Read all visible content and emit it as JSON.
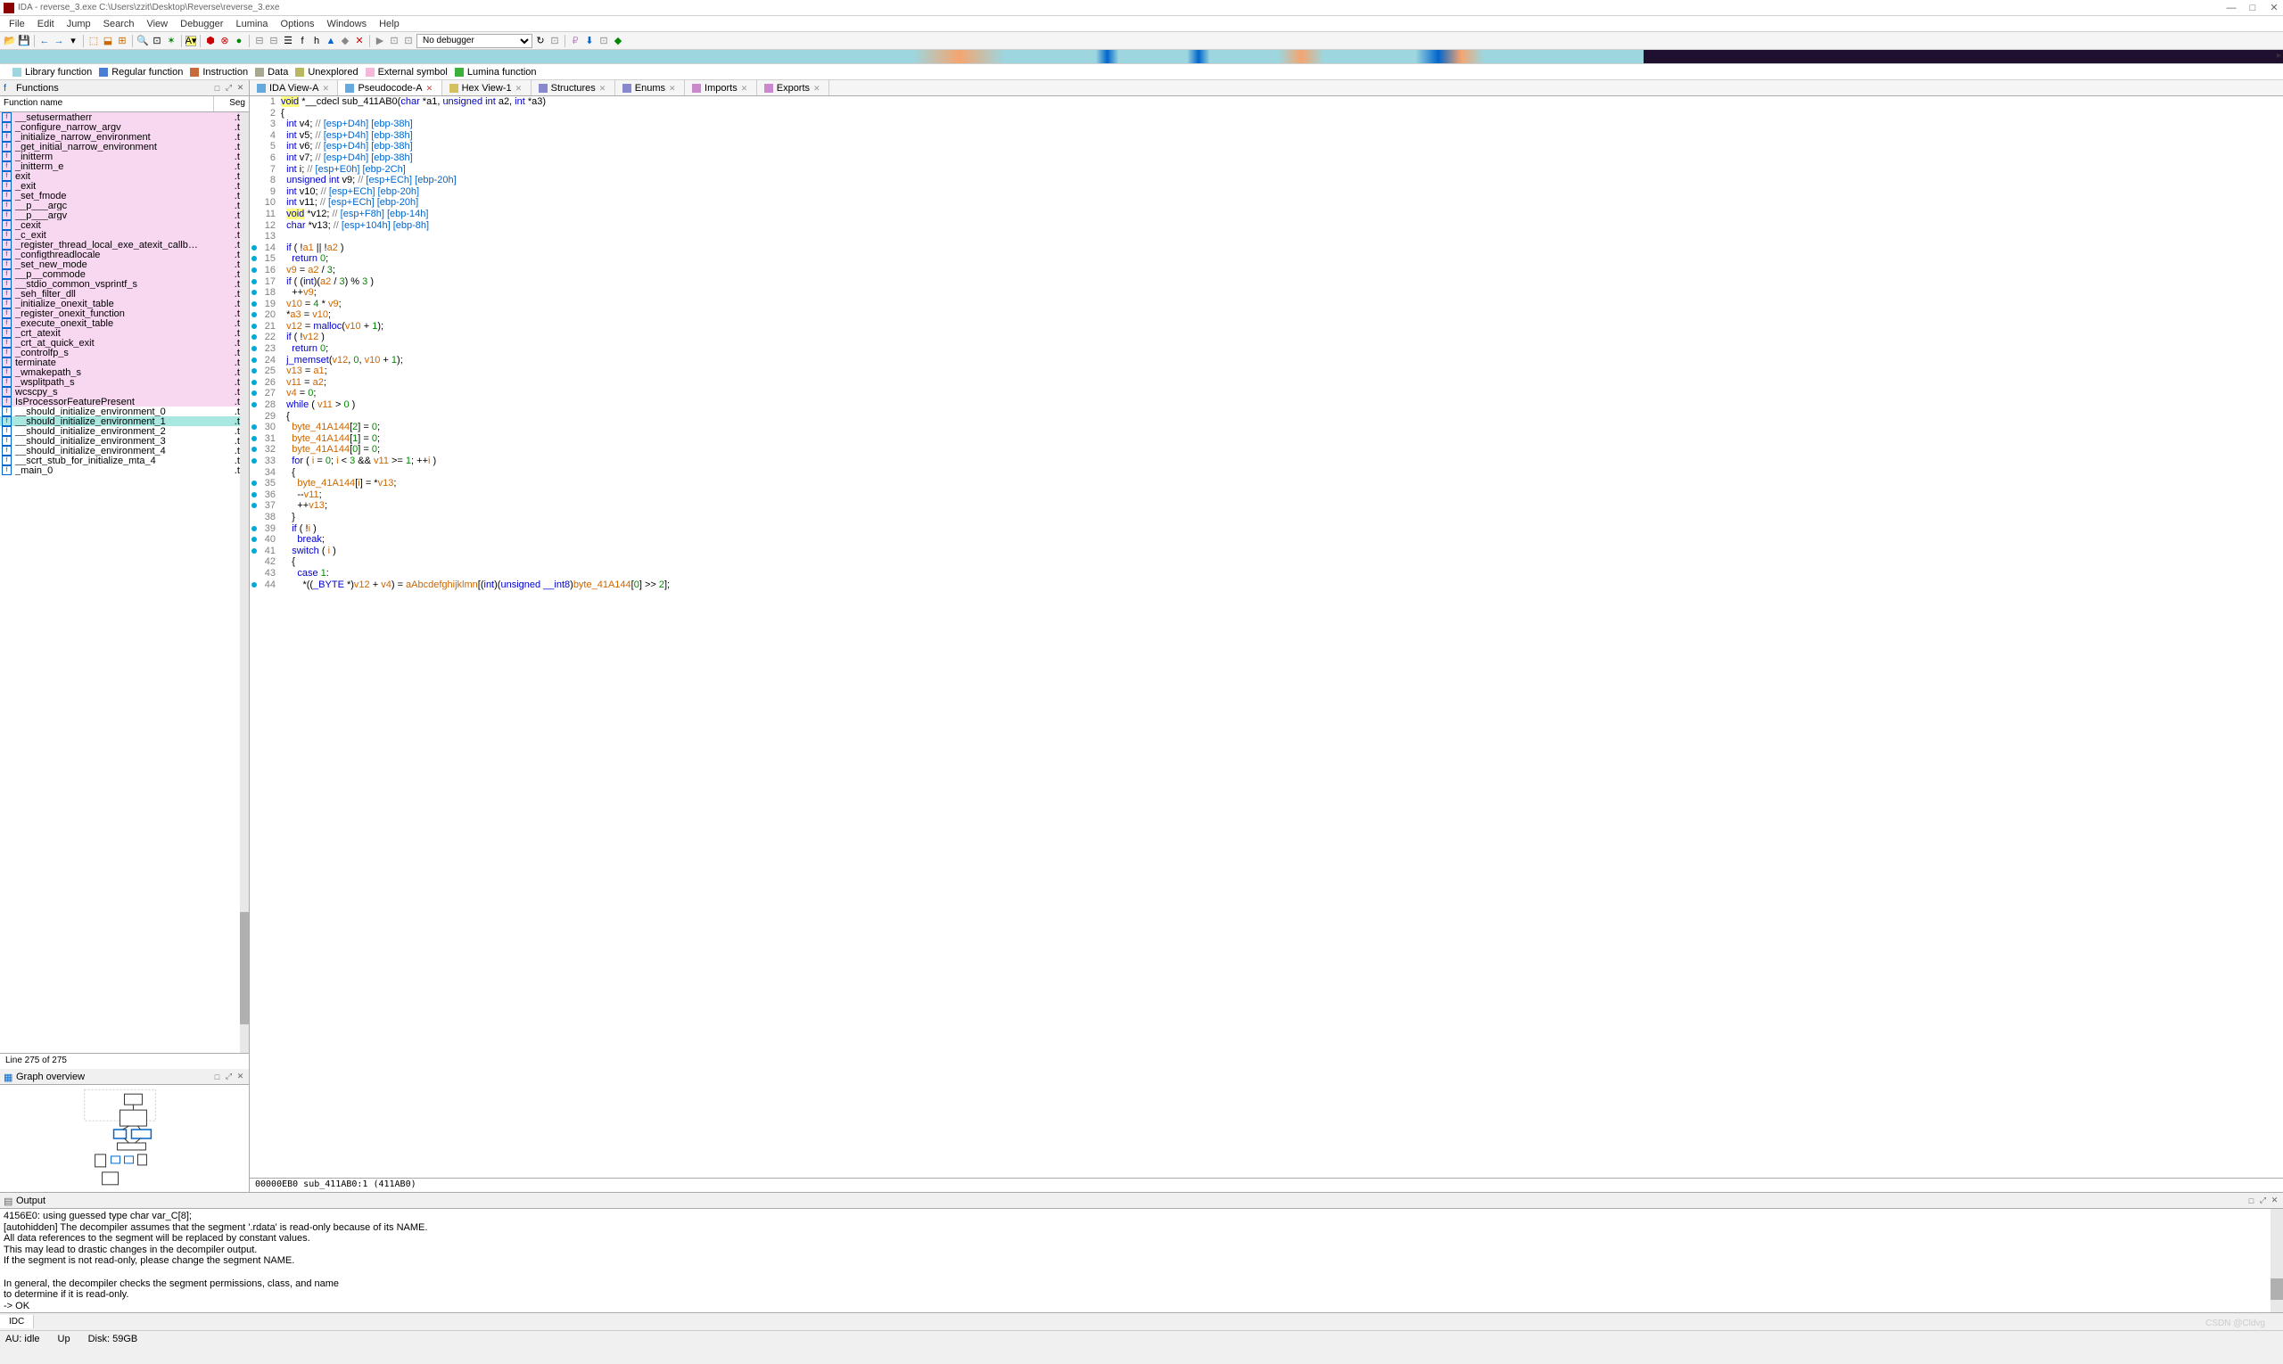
{
  "title": "IDA - reverse_3.exe C:\\Users\\zzit\\Desktop\\Reverse\\reverse_3.exe",
  "menu": [
    "File",
    "Edit",
    "Jump",
    "Search",
    "View",
    "Debugger",
    "Lumina",
    "Options",
    "Windows",
    "Help"
  ],
  "debugger_combo": "No debugger",
  "legend": [
    {
      "c": "#9dd6df",
      "t": "Library function"
    },
    {
      "c": "#4a7dd4",
      "t": "Regular function"
    },
    {
      "c": "#c96a3b",
      "t": "Instruction"
    },
    {
      "c": "#a8a890",
      "t": "Data"
    },
    {
      "c": "#b8b860",
      "t": "Unexplored"
    },
    {
      "c": "#f5b8d8",
      "t": "External symbol"
    },
    {
      "c": "#3bb03b",
      "t": "Lumina function"
    }
  ],
  "functions_panel": {
    "title": "Functions",
    "col1": "Function name",
    "col2": "Seg",
    "status": "Line 275 of 275"
  },
  "functions": [
    {
      "n": "__setusermatherr",
      "s": ".te",
      "bg": "pink"
    },
    {
      "n": "_configure_narrow_argv",
      "s": ".te",
      "bg": "pink"
    },
    {
      "n": "_initialize_narrow_environment",
      "s": ".te",
      "bg": "pink"
    },
    {
      "n": "_get_initial_narrow_environment",
      "s": ".te",
      "bg": "pink"
    },
    {
      "n": "_initterm",
      "s": ".te",
      "bg": "pink"
    },
    {
      "n": "_initterm_e",
      "s": ".te",
      "bg": "pink"
    },
    {
      "n": "exit",
      "s": ".te",
      "bg": "pink"
    },
    {
      "n": "_exit",
      "s": ".te",
      "bg": "pink"
    },
    {
      "n": "_set_fmode",
      "s": ".te",
      "bg": "pink"
    },
    {
      "n": "__p___argc",
      "s": ".te",
      "bg": "pink"
    },
    {
      "n": "__p___argv",
      "s": ".te",
      "bg": "pink"
    },
    {
      "n": "_cexit",
      "s": ".te",
      "bg": "pink"
    },
    {
      "n": "_c_exit",
      "s": ".te",
      "bg": "pink"
    },
    {
      "n": "_register_thread_local_exe_atexit_callb…",
      "s": ".te",
      "bg": "pink"
    },
    {
      "n": "_configthreadlocale",
      "s": ".te",
      "bg": "pink"
    },
    {
      "n": "_set_new_mode",
      "s": ".te",
      "bg": "pink"
    },
    {
      "n": "__p__commode",
      "s": ".te",
      "bg": "pink"
    },
    {
      "n": "__stdio_common_vsprintf_s",
      "s": ".te",
      "bg": "pink"
    },
    {
      "n": "_seh_filter_dll",
      "s": ".te",
      "bg": "pink"
    },
    {
      "n": "_initialize_onexit_table",
      "s": ".te",
      "bg": "pink"
    },
    {
      "n": "_register_onexit_function",
      "s": ".te",
      "bg": "pink"
    },
    {
      "n": "_execute_onexit_table",
      "s": ".te",
      "bg": "pink"
    },
    {
      "n": "_crt_atexit",
      "s": ".te",
      "bg": "pink"
    },
    {
      "n": "_crt_at_quick_exit",
      "s": ".te",
      "bg": "pink"
    },
    {
      "n": "_controlfp_s",
      "s": ".te",
      "bg": "pink"
    },
    {
      "n": "terminate",
      "s": ".te",
      "bg": "pink"
    },
    {
      "n": "_wmakepath_s",
      "s": ".te",
      "bg": "pink"
    },
    {
      "n": "_wsplitpath_s",
      "s": ".te",
      "bg": "pink"
    },
    {
      "n": "wcscpy_s",
      "s": ".te",
      "bg": "pink"
    },
    {
      "n": "IsProcessorFeaturePresent",
      "s": ".te",
      "bg": "pink"
    },
    {
      "n": "__should_initialize_environment_0",
      "s": ".te",
      "bg": "white"
    },
    {
      "n": "__should_initialize_environment_1",
      "s": ".te",
      "bg": "teal"
    },
    {
      "n": "__should_initialize_environment_2",
      "s": ".te",
      "bg": "white"
    },
    {
      "n": "__should_initialize_environment_3",
      "s": ".te",
      "bg": "white"
    },
    {
      "n": "__should_initialize_environment_4",
      "s": ".te",
      "bg": "white"
    },
    {
      "n": "__scrt_stub_for_initialize_mta_4",
      "s": ".te",
      "bg": "white"
    },
    {
      "n": "_main_0",
      "s": ".te",
      "bg": "white"
    }
  ],
  "graph_panel": {
    "title": "Graph overview"
  },
  "tabs": [
    {
      "label": "IDA View-A",
      "ico": "#66aadd"
    },
    {
      "label": "Pseudocode-A",
      "ico": "#66aadd",
      "active": true,
      "close": "red"
    },
    {
      "label": "Hex View-1",
      "ico": "#d4c060"
    },
    {
      "label": "Structures",
      "ico": "#8888cc"
    },
    {
      "label": "Enums",
      "ico": "#8888cc"
    },
    {
      "label": "Imports",
      "ico": "#cc88cc"
    },
    {
      "label": "Exports",
      "ico": "#cc88cc"
    }
  ],
  "code": [
    {
      "n": 1,
      "h": "<span class='hl ty'>void</span> *__cdecl sub_411AB0(<span class='ty'>char</span> *a1, <span class='ty'>unsigned int</span> a2, <span class='ty'>int</span> *a3)"
    },
    {
      "n": 2,
      "h": "{"
    },
    {
      "n": 3,
      "h": "  <span class='ty'>int</span> v4; <span class='cm'>// </span><span class='cmr'>[esp+D4h] [ebp-38h]</span>"
    },
    {
      "n": 4,
      "h": "  <span class='ty'>int</span> v5; <span class='cm'>// </span><span class='cmr'>[esp+D4h] [ebp-38h]</span>"
    },
    {
      "n": 5,
      "h": "  <span class='ty'>int</span> v6; <span class='cm'>// </span><span class='cmr'>[esp+D4h] [ebp-38h]</span>"
    },
    {
      "n": 6,
      "h": "  <span class='ty'>int</span> v7; <span class='cm'>// </span><span class='cmr'>[esp+D4h] [ebp-38h]</span>"
    },
    {
      "n": 7,
      "h": "  <span class='kw'>int</span> i; <span class='cm'>// </span><span class='cmr'>[esp+E0h] [ebp-2Ch]</span>"
    },
    {
      "n": 8,
      "h": "  <span class='kw'>unsigned int</span> v9; <span class='cm'>// </span><span class='cmr'>[esp+ECh] [ebp-20h]</span>"
    },
    {
      "n": 9,
      "h": "  <span class='kw'>int</span> v10; <span class='cm'>// </span><span class='cmr'>[esp+ECh] [ebp-20h]</span>"
    },
    {
      "n": 10,
      "h": "  <span class='kw'>int</span> v11; <span class='cm'>// </span><span class='cmr'>[esp+ECh] [ebp-20h]</span>"
    },
    {
      "n": 11,
      "h": "  <span class='hl ty'>void</span> *v12; <span class='cm'>// </span><span class='cmr'>[esp+F8h] [ebp-14h]</span>"
    },
    {
      "n": 12,
      "h": "  <span class='kw'>char</span> *v13; <span class='cm'>// </span><span class='cmr'>[esp+104h] [ebp-8h]</span>"
    },
    {
      "n": 13,
      "h": ""
    },
    {
      "n": 14,
      "bp": 1,
      "h": "  <span class='kw'>if</span> ( !<span class='nm2'>a1</span> || !<span class='nm2'>a2</span> )"
    },
    {
      "n": 15,
      "bp": 1,
      "h": "    <span class='kw'>return</span> <span class='num'>0</span>;"
    },
    {
      "n": 16,
      "bp": 1,
      "h": "  <span class='nm2'>v9</span> = <span class='nm2'>a2</span> / <span class='num'>3</span>;"
    },
    {
      "n": 17,
      "bp": 1,
      "h": "  <span class='kw'>if</span> ( (<span class='ty'>int</span>)(<span class='nm2'>a2</span> / <span class='num'>3</span>) % <span class='num'>3</span> )"
    },
    {
      "n": 18,
      "bp": 1,
      "h": "    ++<span class='nm2'>v9</span>;"
    },
    {
      "n": 19,
      "bp": 1,
      "h": "  <span class='nm2'>v10</span> = <span class='num'>4</span> * <span class='nm2'>v9</span>;"
    },
    {
      "n": 20,
      "bp": 1,
      "h": "  *<span class='nm2'>a3</span> = <span class='nm2'>v10</span>;"
    },
    {
      "n": 21,
      "bp": 1,
      "h": "  <span class='nm2'>v12</span> = <span class='fn'>malloc</span>(<span class='nm2'>v10</span> + <span class='num'>1</span>);"
    },
    {
      "n": 22,
      "bp": 1,
      "h": "  <span class='kw'>if</span> ( !<span class='nm2'>v12</span> )"
    },
    {
      "n": 23,
      "bp": 1,
      "h": "    <span class='kw'>return</span> <span class='num'>0</span>;"
    },
    {
      "n": 24,
      "bp": 1,
      "h": "  <span class='fn'>j_memset</span>(<span class='nm2'>v12</span>, <span class='num'>0</span>, <span class='nm2'>v10</span> + <span class='num'>1</span>);"
    },
    {
      "n": 25,
      "bp": 1,
      "h": "  <span class='nm2'>v13</span> = <span class='nm2'>a1</span>;"
    },
    {
      "n": 26,
      "bp": 1,
      "h": "  <span class='nm2'>v11</span> = <span class='nm2'>a2</span>;"
    },
    {
      "n": 27,
      "bp": 1,
      "h": "  <span class='nm2'>v4</span> = <span class='num'>0</span>;"
    },
    {
      "n": 28,
      "bp": 1,
      "h": "  <span class='kw'>while</span> ( <span class='nm2'>v11</span> &gt; <span class='num'>0</span> )"
    },
    {
      "n": 29,
      "h": "  {"
    },
    {
      "n": 30,
      "bp": 1,
      "h": "    <span class='nm2'>byte_41A144</span>[<span class='num'>2</span>] = <span class='num'>0</span>;"
    },
    {
      "n": 31,
      "bp": 1,
      "h": "    <span class='nm2'>byte_41A144</span>[<span class='num'>1</span>] = <span class='num'>0</span>;"
    },
    {
      "n": 32,
      "bp": 1,
      "h": "    <span class='nm2'>byte_41A144</span>[<span class='num'>0</span>] = <span class='num'>0</span>;"
    },
    {
      "n": 33,
      "bp": 1,
      "h": "    <span class='kw'>for</span> ( <span class='nm2'>i</span> = <span class='num'>0</span>; <span class='nm2'>i</span> &lt; <span class='num'>3</span> &amp;&amp; <span class='nm2'>v11</span> &gt;= <span class='num'>1</span>; ++<span class='nm2'>i</span> )"
    },
    {
      "n": 34,
      "h": "    {"
    },
    {
      "n": 35,
      "bp": 1,
      "h": "      <span class='nm2'>byte_41A144</span>[<span class='nm2'>i</span>] = *<span class='nm2'>v13</span>;"
    },
    {
      "n": 36,
      "bp": 1,
      "h": "      --<span class='nm2'>v11</span>;"
    },
    {
      "n": 37,
      "bp": 1,
      "h": "      ++<span class='nm2'>v13</span>;"
    },
    {
      "n": 38,
      "h": "    }"
    },
    {
      "n": 39,
      "bp": 1,
      "h": "    <span class='kw'>if</span> ( !<span class='nm2'>i</span> )"
    },
    {
      "n": 40,
      "bp": 1,
      "h": "      <span class='kw'>break</span>;"
    },
    {
      "n": 41,
      "bp": 1,
      "h": "    <span class='kw'>switch</span> ( <span class='nm2'>i</span> )"
    },
    {
      "n": 42,
      "h": "    {"
    },
    {
      "n": 43,
      "h": "      <span class='kw'>case</span> <span class='num'>1</span>:"
    },
    {
      "n": 44,
      "bp": 1,
      "h": "        *((<span class='ty'>_BYTE</span> *)<span class='nm2'>v12</span> + <span class='nm2'>v4</span>) = <span class='nm2'>aAbcdefghijklmn</span>[(<span class='ty'>int</span>)(<span class='ty'>unsigned __int8</span>)<span class='nm2'>byte_41A144</span>[<span class='num'>0</span>] &gt;&gt; <span class='num'>2</span>];"
    }
  ],
  "code_status": "00000EB0 sub_411AB0:1 (411AB0)",
  "output_panel": {
    "title": "Output"
  },
  "output": [
    "4156E0: using guessed type char var_C[8];",
    "[autohidden] The decompiler assumes that the segment '.rdata' is read-only because of its NAME.",
    "All data references to the segment will be replaced by constant values.",
    "This may lead to drastic changes in the decompiler output.",
    "If the segment is not read-only, please change the segment NAME.",
    "",
    "In general, the decompiler checks the segment permissions, class, and name",
    "to determine if it is read-only.",
    "-> OK"
  ],
  "bottom_tab": "IDC",
  "status": {
    "au": "AU:",
    "idle": "idle",
    "up": "Up",
    "disk": "Disk: 59GB"
  },
  "watermark": "CSDN @Cldvg"
}
